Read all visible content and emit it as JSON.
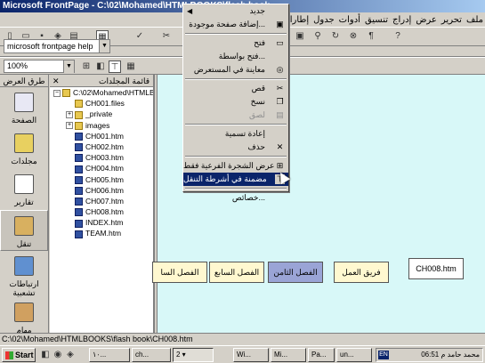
{
  "window": {
    "title": "Microsoft FrontPage - C:\\02\\Mohamed\\HTMLBOOKS\\flash book"
  },
  "menubar": [
    "ملف",
    "تحرير",
    "عرض",
    "إدراج",
    "تنسيق",
    "أدوات",
    "جدول",
    "إطارات"
  ],
  "toolbar": {
    "style_value": "microsoft frontpage help",
    "zoom_value": "100%"
  },
  "views_bar": {
    "title": "طرق العرض",
    "items": [
      {
        "label": "الصفحة",
        "icon": "page-icon"
      },
      {
        "label": "مجلدات",
        "icon": "folders-icon"
      },
      {
        "label": "تقارير",
        "icon": "reports-icon"
      },
      {
        "label": "تنقل",
        "icon": "navigation-icon",
        "active": true
      },
      {
        "label": "ارتباطات تشعبية",
        "icon": "hyperlinks-icon"
      },
      {
        "label": "مهام",
        "icon": "tasks-icon"
      }
    ]
  },
  "folder_list": {
    "title": "قائمة المجلدات",
    "root": "C:\\02\\Mohamed\\HTMLBOOKS",
    "items": [
      {
        "label": "CH001.files",
        "kind": "folder"
      },
      {
        "label": "_private",
        "kind": "folder"
      },
      {
        "label": "images",
        "kind": "folder"
      },
      {
        "label": "CH001.htm",
        "kind": "page"
      },
      {
        "label": "CH002.htm",
        "kind": "page"
      },
      {
        "label": "CH003.htm",
        "kind": "page"
      },
      {
        "label": "CH004.htm",
        "kind": "page"
      },
      {
        "label": "CH005.htm",
        "kind": "page"
      },
      {
        "label": "CH006.htm",
        "kind": "page"
      },
      {
        "label": "CH007.htm",
        "kind": "page"
      },
      {
        "label": "CH008.htm",
        "kind": "page"
      },
      {
        "label": "INDEX.htm",
        "kind": "page"
      },
      {
        "label": "TEAM.htm",
        "kind": "page"
      }
    ]
  },
  "navigation": {
    "boxes": [
      {
        "label": "الفصل السا"
      },
      {
        "label": "الفصل السابع"
      },
      {
        "label": "الفصل الثامن"
      },
      {
        "label": "فريق العمل"
      },
      {
        "label": "CH008.htm"
      }
    ]
  },
  "context_menu": {
    "items": [
      {
        "label": "جديد",
        "submenu": true
      },
      {
        "label": "إضافة صفحة موجودة..."
      },
      {
        "sep": true
      },
      {
        "label": "فتح"
      },
      {
        "label": "فتح بواسطة..."
      },
      {
        "label": "معاينة في المستعرض"
      },
      {
        "sep": true
      },
      {
        "label": "قص"
      },
      {
        "label": "نسخ"
      },
      {
        "label": "لصق",
        "disabled": true
      },
      {
        "sep": true
      },
      {
        "label": "إعادة تسمية"
      },
      {
        "label": "حذف"
      },
      {
        "sep": true
      },
      {
        "label": "عرض الشجرة الفرعية فقط"
      },
      {
        "label": "مضمنة في أشرطة التنقل",
        "highlighted": true
      },
      {
        "sep": true
      },
      {
        "label": "خصائص..."
      }
    ]
  },
  "statusbar": {
    "text": "C:\\02\\Mohamed\\HTMLBOOKS\\flash book\\CH008.htm"
  },
  "taskbar": {
    "start_label": "Start",
    "tasks": [
      "۱۰...",
      "ch...",
      "2 ▾",
      "Wi...",
      "Mi...",
      "Pa...",
      "un..."
    ],
    "lang": "EN",
    "clock": "محمد حامد م 06:51"
  }
}
